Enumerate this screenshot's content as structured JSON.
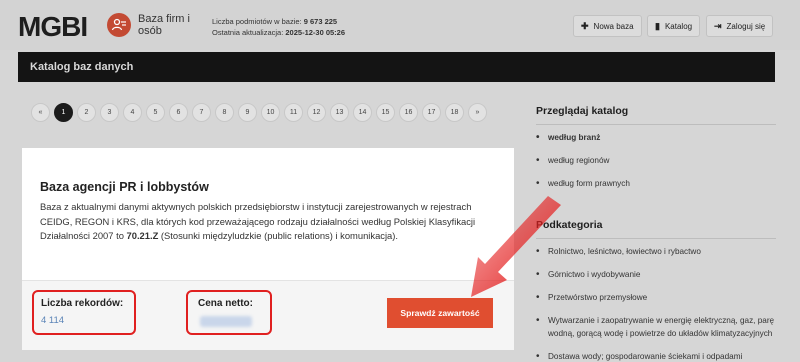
{
  "header": {
    "logo": "MGBI",
    "logo_sub": "Baza firm i osób",
    "stats": {
      "count_label": "Liczba podmiotów w bazie:",
      "count_value": "9 673 225",
      "updated_label": "Ostatnia aktualizacja:",
      "updated_value": "2025-12-30 05:26"
    },
    "buttons": [
      {
        "label": "Nowa baza",
        "icon": "plus-icon"
      },
      {
        "label": "Katalog",
        "icon": "book-icon"
      },
      {
        "label": "Zaloguj się",
        "icon": "login-icon"
      }
    ]
  },
  "banner": {
    "title": "Katalog baz danych"
  },
  "pagination": {
    "prev": "«",
    "next": "»",
    "pages": [
      "1",
      "2",
      "3",
      "4",
      "5",
      "6",
      "7",
      "8",
      "9",
      "10",
      "11",
      "12",
      "13",
      "14",
      "15",
      "16",
      "17",
      "18"
    ],
    "active": "1"
  },
  "sidebar": {
    "browse_title": "Przeglądaj katalog",
    "browse_items": [
      "według branż",
      "według regionów",
      "według form prawnych"
    ],
    "category_title": "Podkategoria",
    "category_items": [
      "Rolnictwo, leśnictwo, łowiectwo i rybactwo",
      "Górnictwo i wydobywanie",
      "Przetwórstwo przemysłowe",
      "Wytwarzanie i zaopatrywanie w energię elektryczną, gaz, parę wodną, gorącą wodę i powietrze do układów klimatyzacyjnych",
      "Dostawa wody; gospodarowanie ściekami i odpadami"
    ]
  },
  "card": {
    "title": "Baza agencji PR i lobbystów",
    "desc_before": "Baza z aktualnymi danymi aktywnych polskich przedsiębiorstw i instytucji zarejestrowanych w rejestrach CEIDG, REGON i KRS, dla których kod przeważającego rodzaju działalności według Polskiej Klasyfikacji Działalności 2007 to ",
    "desc_code": "70.21.Z",
    "desc_after": " (Stosunki międzyludzkie (public relations) i komunikacja).",
    "records_label": "Liczba rekordów:",
    "records_value": "4 114",
    "price_label": "Cena netto:",
    "cta": "Sprawdź zawartość"
  },
  "colors": {
    "accent": "#e04e30",
    "highlight": "#e02020",
    "banner": "#141414",
    "link": "#5b84b7"
  }
}
